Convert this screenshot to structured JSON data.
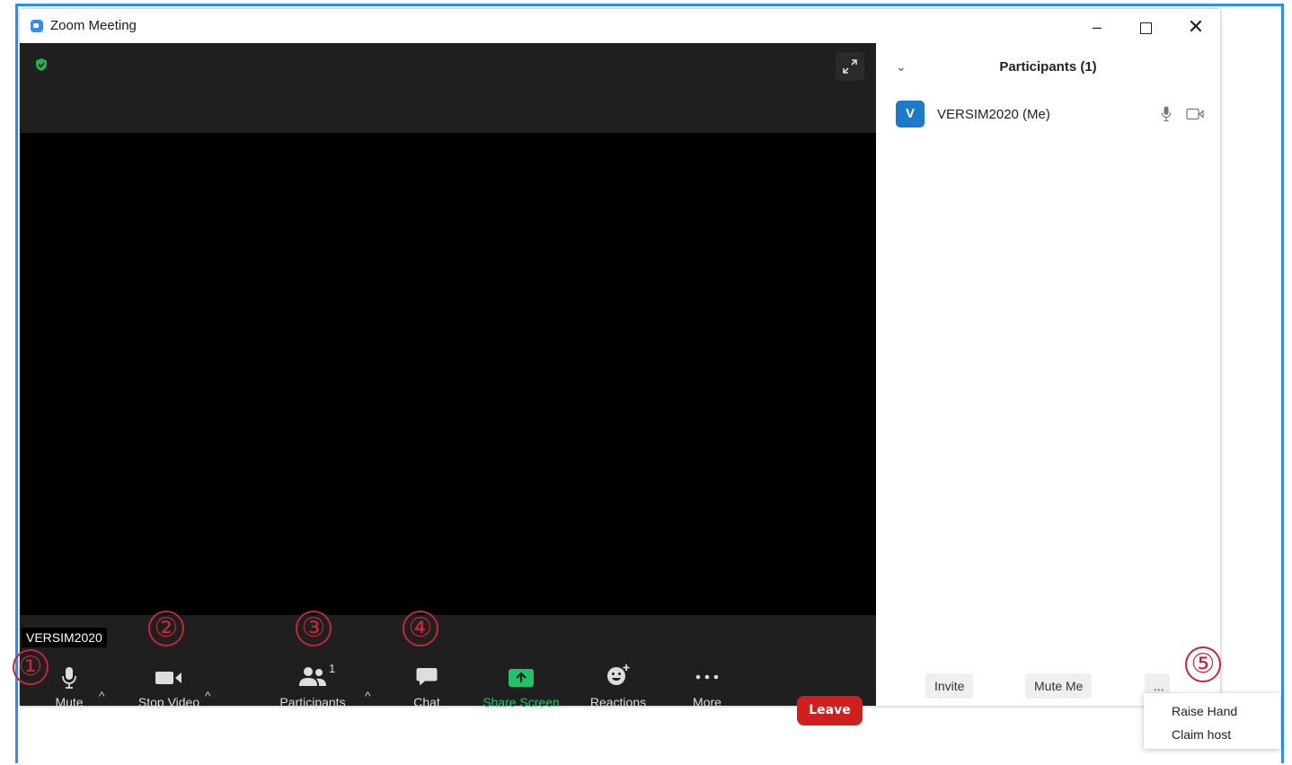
{
  "window": {
    "title": "Zoom Meeting",
    "min_glyph": "–",
    "close_glyph": "✕"
  },
  "video": {
    "name_tag": "VERSIM2020"
  },
  "toolbar": {
    "mute_label": "Mute",
    "video_label": "Stop Video",
    "participants_label": "Participants",
    "participants_count": "1",
    "chat_label": "Chat",
    "share_label": "Share Screen",
    "reactions_label": "Reactions",
    "more_label": "More",
    "leave_label": "Leave",
    "caret": "^"
  },
  "panel": {
    "title": "Participants (1)",
    "collapse_glyph": "⌄",
    "participant": {
      "initial": "V",
      "name": "VERSIM2020 (Me)"
    },
    "invite_label": "Invite",
    "mute_me_label": "Mute Me",
    "more_label": "..."
  },
  "dropdown": {
    "items": [
      "Raise Hand",
      "Claim host"
    ]
  },
  "annotations": [
    "①",
    "②",
    "③",
    "④",
    "⑤"
  ],
  "colors": {
    "accent": "#2d8cff",
    "leave": "#d11f1f",
    "share": "#22c26a",
    "annotation": "#c0283c"
  }
}
